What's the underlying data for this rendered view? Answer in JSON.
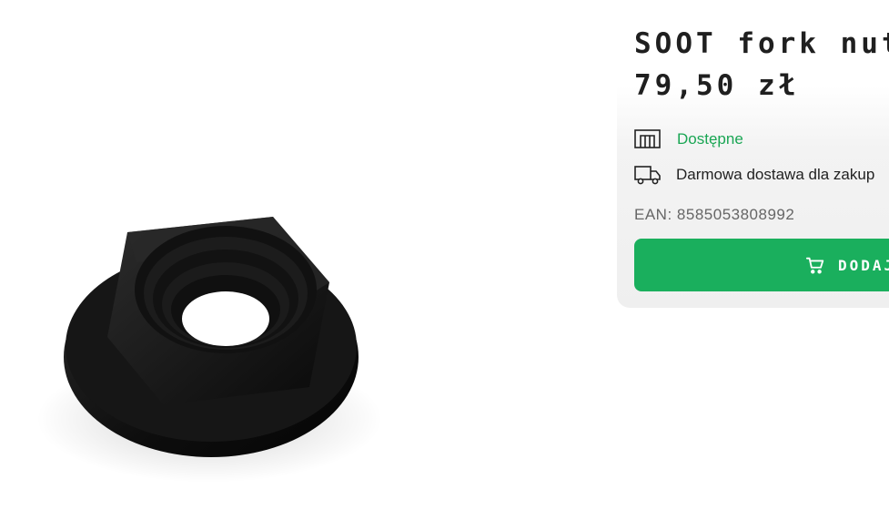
{
  "product": {
    "title": "SOOT fork nut",
    "price": "79,50 zł",
    "image_icon": "fork-nut-product-image"
  },
  "availability": {
    "icon": "warehouse-icon",
    "text": "Dostępne",
    "color": "#1aa654"
  },
  "shipping": {
    "icon": "truck-icon",
    "text": "Darmowa dostawa dla zakup"
  },
  "ean": {
    "label": "EAN:",
    "value": "8585053808992"
  },
  "cart": {
    "icon": "cart-icon",
    "label": "DODAJ",
    "color": "#1aaf5d"
  }
}
